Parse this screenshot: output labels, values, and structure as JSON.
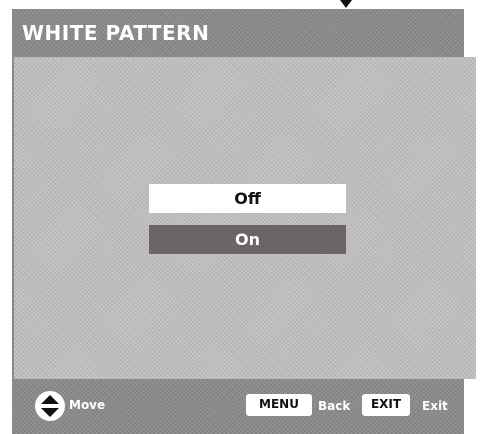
{
  "header": {
    "title": "WHITE PATTERN"
  },
  "options": {
    "items": [
      {
        "label": "Off",
        "selected": false
      },
      {
        "label": "On",
        "selected": true
      }
    ]
  },
  "footer": {
    "move_label": "Move",
    "menu_key": "MENU",
    "back_label": "Back",
    "exit_key": "EXIT",
    "exit_label": "Exit"
  },
  "icons": {
    "pointer": "down-arrow-icon",
    "move": "up-down-arrows-icon"
  },
  "colors": {
    "frame": "#8a8a8a",
    "panel": "#bcbcbc",
    "unselected_option_bg": "#ffffff",
    "selected_option_bg": "#6b6665",
    "title_text": "#ffffff"
  }
}
